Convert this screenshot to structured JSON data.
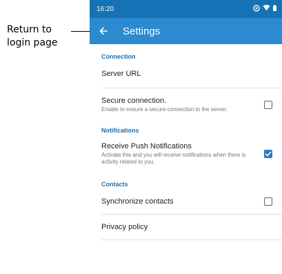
{
  "annotation": {
    "line1": "Return to",
    "line2": "login page"
  },
  "status_bar": {
    "time": "16:20",
    "icons": [
      "sync-icon",
      "wifi-icon",
      "battery-icon"
    ]
  },
  "app_bar": {
    "back_icon": "arrow-left-icon",
    "title": "Settings"
  },
  "sections": {
    "connection": {
      "header": "Connection",
      "server_url": "Server URL",
      "secure_title": "Secure connection.",
      "secure_desc": "Enable to ensure a secure connection to the server.",
      "secure_checked": false
    },
    "notifications": {
      "header": "Notifications",
      "push_title": "Receive Push Notifications",
      "push_desc": "Activate this and you will receive notifications when there is activity related to you.",
      "push_checked": true
    },
    "contacts": {
      "header": "Contacts",
      "sync_title": "Synchronize contacts",
      "sync_checked": false
    },
    "privacy": {
      "title": "Privacy policy"
    }
  },
  "colors": {
    "status_bar": "#1572b4",
    "app_bar": "#2b8ad0",
    "accent": "#1e6fb0",
    "checkbox_checked": "#2b78c6"
  }
}
